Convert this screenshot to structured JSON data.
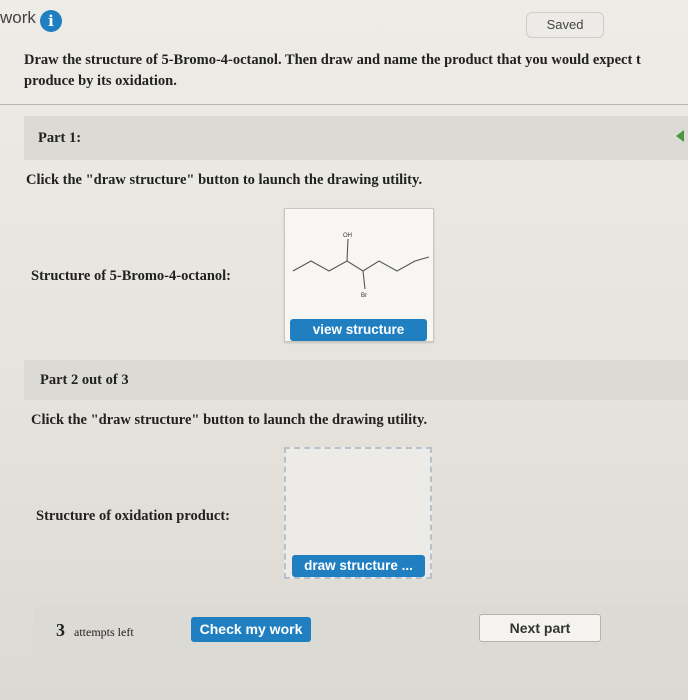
{
  "header": {
    "brand_text": "work",
    "info_icon_glyph": "i",
    "saved_label": "Saved"
  },
  "question": {
    "line1": "Draw the structure of 5-Bromo-4-octanol. Then draw and name the product that you would expect t",
    "line2": "produce by its oxidation."
  },
  "part1": {
    "title": "Part 1:",
    "instruction": "Click the \"draw structure\" button to launch the drawing utility.",
    "structure_label": "Structure of 5-Bromo-4-octanol:",
    "molecule": {
      "oh_label": "OH",
      "br_label": "Br"
    },
    "view_button": "view structure"
  },
  "part2": {
    "title": "Part 2 out of 3",
    "instruction": "Click the \"draw structure\" button to launch the drawing utility.",
    "structure_label": "Structure of oxidation product:",
    "draw_button": "draw structure ..."
  },
  "footer": {
    "attempts_count": "3",
    "attempts_text": "attempts left",
    "check_button": "Check my work",
    "next_button": "Next part"
  },
  "colors": {
    "accent_blue": "#1f7fc1",
    "section_gray": "#dcdad5",
    "chevron_green": "#4a9a3b"
  }
}
